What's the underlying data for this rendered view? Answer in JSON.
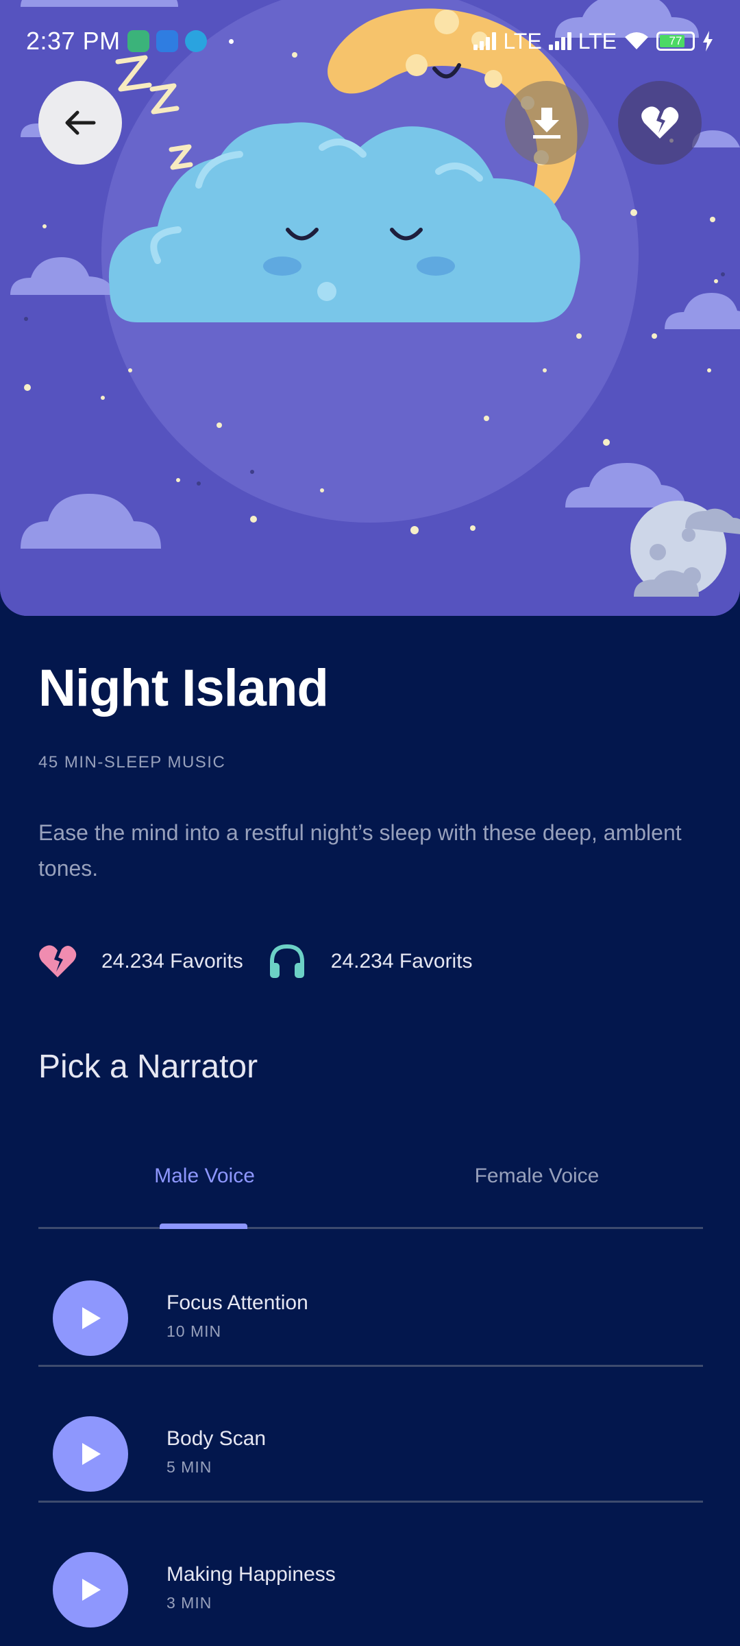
{
  "status_bar": {
    "time": "2:37 PM",
    "network_1": "LTE",
    "network_2": "LTE",
    "battery": "77"
  },
  "hero": {
    "icons": [
      "arrow-left-icon",
      "download-icon",
      "broken-heart-icon"
    ]
  },
  "detail": {
    "title": "Night Island",
    "subtitle": "45 MIN-SLEEP MUSIC",
    "description": "Ease the mind into a restful night’s sleep  with these deep, amblent tones.",
    "favorites_label": "24.234 Favorits",
    "listens_label": "24.234 Favorits"
  },
  "narrator": {
    "heading": "Pick a Narrator",
    "tabs": [
      {
        "label": "Male Voice",
        "active": true
      },
      {
        "label": "Female Voice",
        "active": false
      }
    ]
  },
  "tracks": [
    {
      "name": "Focus Attention",
      "duration": "10 MIN"
    },
    {
      "name": "Body Scan",
      "duration": "5 MIN"
    },
    {
      "name": "Making Happiness",
      "duration": "3 MIN"
    }
  ],
  "colors": {
    "background": "#03174D",
    "accent": "#8E97FD",
    "hero": "#5653BF",
    "muted_text": "#98A1BC",
    "heart": "#F08CB0",
    "headphones": "#6CD1C6"
  }
}
